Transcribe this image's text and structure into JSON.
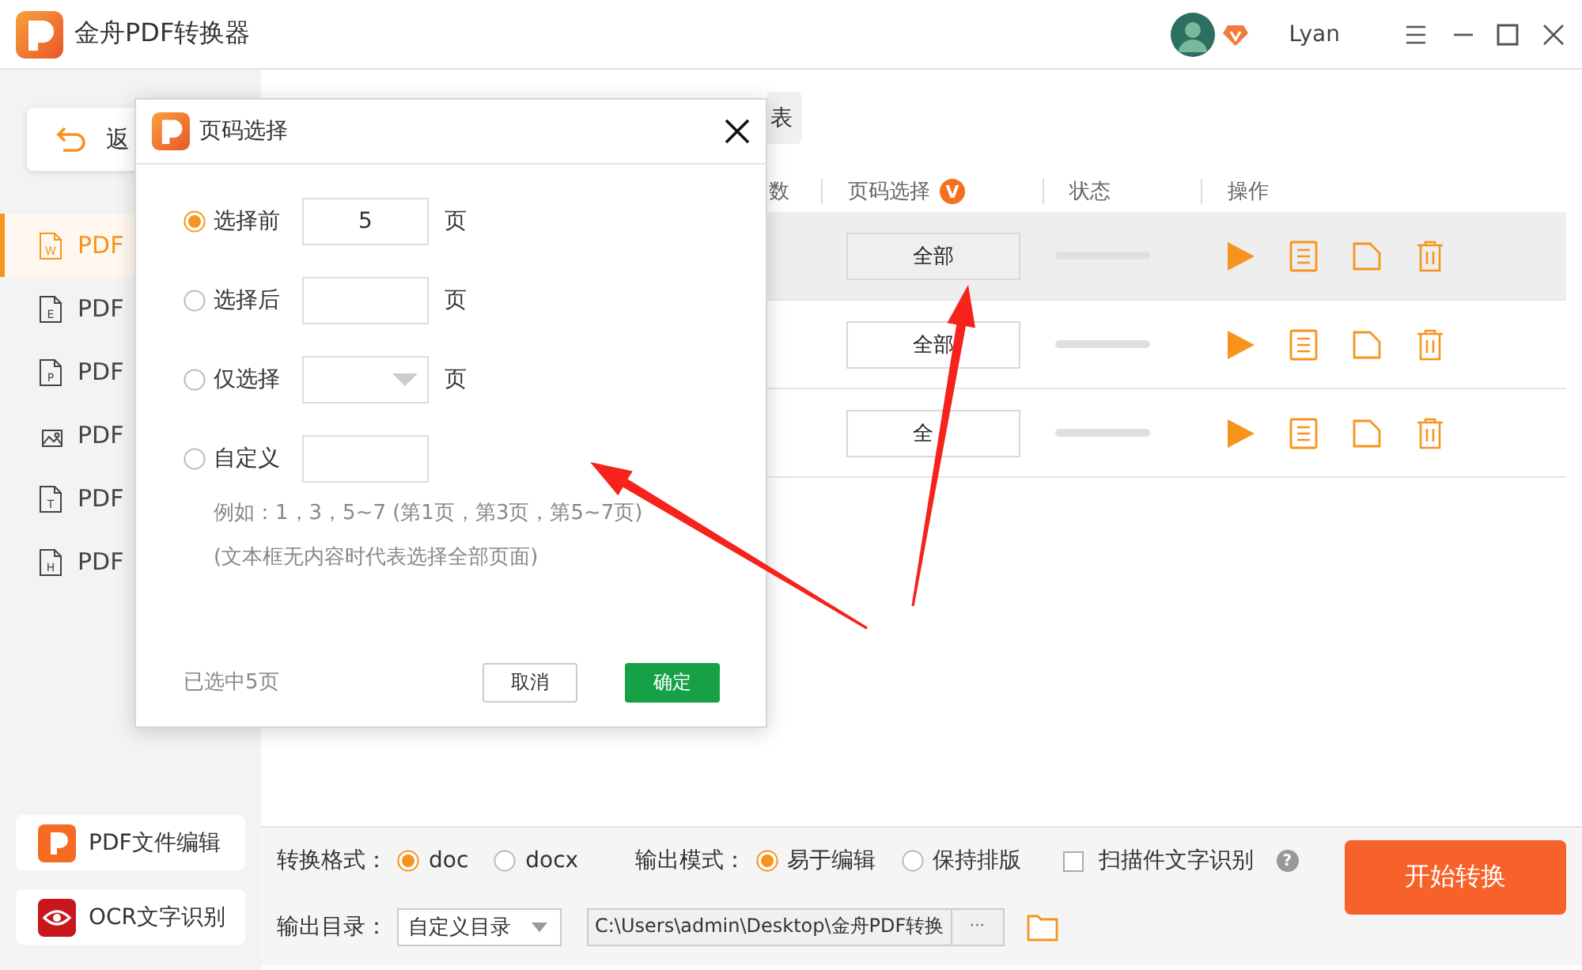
{
  "app": {
    "title": "金舟PDF转换器",
    "user": "Lyan"
  },
  "sidebar": {
    "back": "返",
    "items": [
      {
        "label": "PDF",
        "kind": "doc",
        "mark": "W",
        "selected": true
      },
      {
        "label": "PDF",
        "kind": "doc",
        "mark": "E",
        "selected": false
      },
      {
        "label": "PDF",
        "kind": "doc",
        "mark": "P",
        "selected": false
      },
      {
        "label": "PDF",
        "kind": "image",
        "selected": false
      },
      {
        "label": "PDF",
        "kind": "doc",
        "mark": "T",
        "selected": false
      },
      {
        "label": "PDF",
        "kind": "doc",
        "mark": "H",
        "selected": false
      }
    ],
    "tools": [
      {
        "label": "PDF文件编辑",
        "kind": "edit"
      },
      {
        "label": "OCR文字识别",
        "kind": "ocr"
      }
    ]
  },
  "tabs": [
    {
      "label": "表",
      "selected": false
    }
  ],
  "table": {
    "columns": [
      "数",
      "页码选择",
      "状态",
      "操作"
    ],
    "vip_badge": "V",
    "rows": [
      {
        "pages": "全部",
        "selected": true,
        "level": 0
      },
      {
        "pages": "全部",
        "selected": false,
        "level": 0
      },
      {
        "pages": "全",
        "selected": false,
        "level": 0
      }
    ]
  },
  "options": {
    "format_label": "转换格式：",
    "formats": [
      {
        "label": "doc",
        "selected": true
      },
      {
        "label": "docx",
        "selected": false
      }
    ],
    "mode_label": "输出模式：",
    "modes": [
      {
        "label": "易于编辑",
        "selected": true
      },
      {
        "label": "保持排版",
        "selected": false
      }
    ],
    "ocr": {
      "label": "扫描件文字识别",
      "checked": false
    },
    "help": "?",
    "output_label": "输出目录：",
    "output_select": "自定义目录",
    "output_path": "C:\\Users\\admin\\Desktop\\金舟PDF转换",
    "more": "···",
    "start": "开始转换"
  },
  "dialog": {
    "title": "页码选择",
    "options": [
      {
        "label": "选择前",
        "kind": "input",
        "value": "5",
        "unit": "页",
        "selected": true
      },
      {
        "label": "选择后",
        "kind": "input",
        "unit": "页",
        "selected": false
      },
      {
        "label": "仅选择",
        "kind": "select",
        "unit": "页",
        "selected": false
      },
      {
        "label": "自定义",
        "kind": "input",
        "selected": false
      }
    ],
    "hints": [
      "例如：1，3，5~7 (第1页，第3页，第5~7页)",
      "(文本框无内容时代表选择全部页面)"
    ],
    "summary": "已选中5页",
    "buttons": [
      {
        "label": "取消",
        "kind": "secondary"
      },
      {
        "label": "确定",
        "kind": "primary"
      }
    ]
  }
}
